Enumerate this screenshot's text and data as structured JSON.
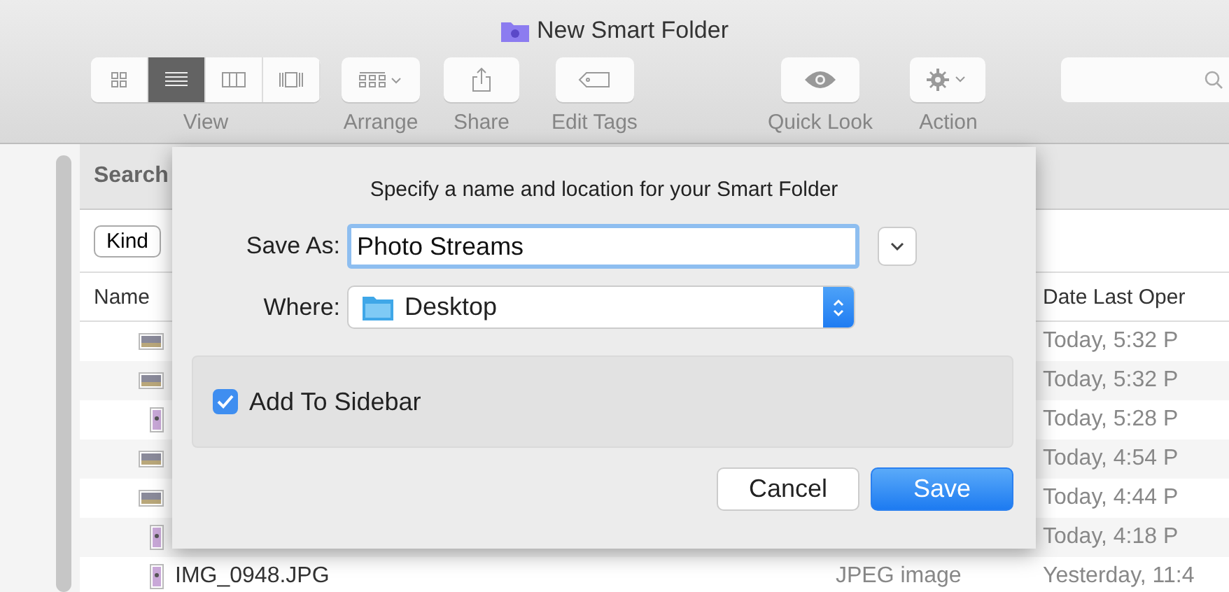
{
  "window": {
    "title": "New Smart Folder"
  },
  "toolbar": {
    "view_modes": [
      {
        "kind": "icons",
        "selected": false
      },
      {
        "kind": "list",
        "selected": true
      },
      {
        "kind": "columns",
        "selected": false
      },
      {
        "kind": "coverflow",
        "selected": false
      }
    ],
    "view_label": "View",
    "items": [
      {
        "kind": "arrange",
        "label": "Arrange"
      },
      {
        "kind": "share",
        "label": "Share"
      },
      {
        "kind": "tags",
        "label": "Edit Tags"
      },
      {
        "kind": "quicklook",
        "label": "Quick Look"
      },
      {
        "kind": "action",
        "label": "Action"
      }
    ]
  },
  "search_header": "Search",
  "filter": {
    "label": "Kind"
  },
  "columns": {
    "name": "Name",
    "date": "Date Last Oper"
  },
  "rows": [
    {
      "kind": "landscape",
      "date": "Today, 5:32 P"
    },
    {
      "kind": "landscape",
      "date": "Today, 5:32 P"
    },
    {
      "kind": "portrait",
      "date": "Today, 5:28 P"
    },
    {
      "kind": "landscape",
      "date": "Today, 4:54 P"
    },
    {
      "kind": "landscape",
      "date": "Today, 4:44 P"
    },
    {
      "kind": "portrait",
      "date": "Today, 4:18 P"
    },
    {
      "kind": "portrait",
      "name": "IMG_0948.JPG",
      "kind_text": "JPEG image",
      "date": "Yesterday, 11:4"
    }
  ],
  "dialog": {
    "message": "Specify a name and location for your Smart Folder",
    "save_as_label": "Save As:",
    "save_as_value": "Photo Streams",
    "where_label": "Where:",
    "where_value": "Desktop",
    "add_to_sidebar": {
      "label": "Add To Sidebar",
      "checked": true
    },
    "buttons": [
      {
        "label": "Cancel",
        "default": false
      },
      {
        "label": "Save",
        "default": true
      }
    ]
  }
}
